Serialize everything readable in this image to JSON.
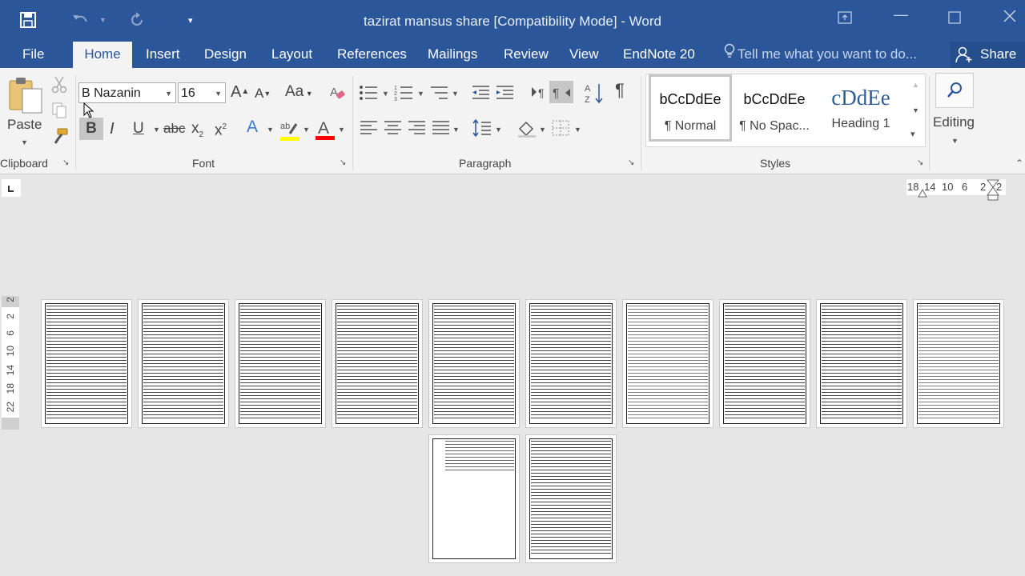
{
  "window": {
    "title": "tazirat mansus share [Compatibility Mode] - Word"
  },
  "tabs": [
    "File",
    "Home",
    "Insert",
    "Design",
    "Layout",
    "References",
    "Mailings",
    "Review",
    "View",
    "EndNote 20"
  ],
  "active_tab": "Home",
  "tell_me": "Tell me what you want to do...",
  "share_label": "Share",
  "clipboard": {
    "paste_label": "Paste",
    "group_label": "Clipboard"
  },
  "font": {
    "name": "B Nazanin",
    "size": "16",
    "group_label": "Font",
    "grow": "A",
    "shrink": "A",
    "case": "Aa",
    "bold": "B",
    "italic": "I",
    "underline": "U",
    "strike": "abc",
    "sub": "x",
    "sup": "x",
    "highlight_color": "#ffff00",
    "font_color": "#ff0000"
  },
  "paragraph": {
    "group_label": "Paragraph",
    "pilcrow": "¶"
  },
  "styles": {
    "group_label": "Styles",
    "items": [
      {
        "preview": "bCcDdEe",
        "name": "¶ Normal"
      },
      {
        "preview": "bCcDdEe",
        "name": "¶ No Spac..."
      },
      {
        "preview": "cDdEe",
        "name": "Heading 1"
      }
    ]
  },
  "editing": {
    "label": "Editing"
  },
  "ruler": {
    "horizontal_numbers": [
      "18",
      "14",
      "10",
      "6",
      "2",
      "2"
    ],
    "vertical_numbers": [
      "2",
      "2",
      "6",
      "10",
      "14",
      "18",
      "22"
    ]
  },
  "document": {
    "page_count": 12
  }
}
